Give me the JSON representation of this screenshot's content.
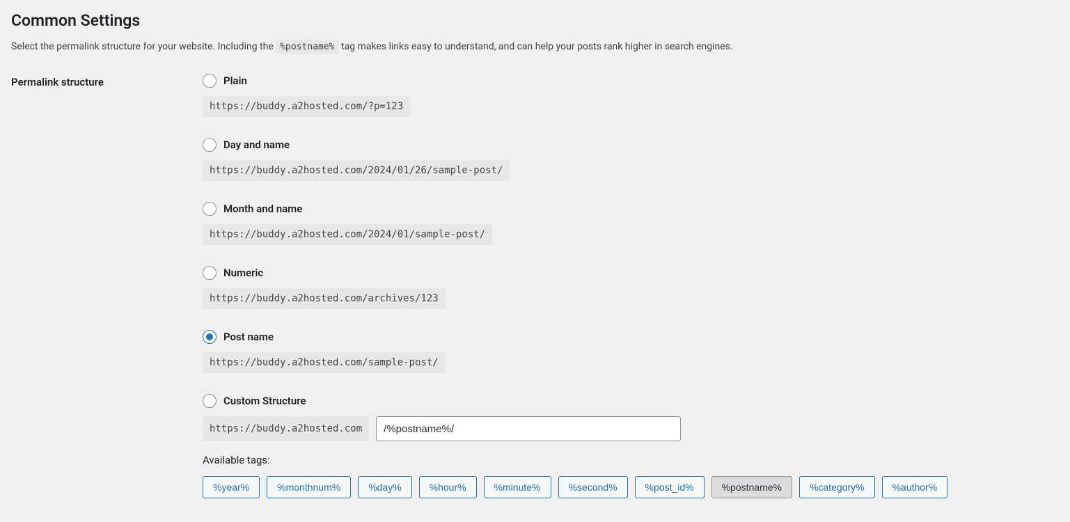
{
  "heading": "Common Settings",
  "intro_before": "Select the permalink structure for your website. Including the ",
  "intro_tag": "%postname%",
  "intro_after": " tag makes links easy to understand, and can help your posts rank higher in search engines.",
  "left_label": "Permalink structure",
  "options": [
    {
      "label": "Plain",
      "example": "https://buddy.a2hosted.com/?p=123",
      "checked": false
    },
    {
      "label": "Day and name",
      "example": "https://buddy.a2hosted.com/2024/01/26/sample-post/",
      "checked": false
    },
    {
      "label": "Month and name",
      "example": "https://buddy.a2hosted.com/2024/01/sample-post/",
      "checked": false
    },
    {
      "label": "Numeric",
      "example": "https://buddy.a2hosted.com/archives/123",
      "checked": false
    },
    {
      "label": "Post name",
      "example": "https://buddy.a2hosted.com/sample-post/",
      "checked": true
    },
    {
      "label": "Custom Structure",
      "checked": false
    }
  ],
  "custom": {
    "prefix": "https://buddy.a2hosted.com",
    "value": "/%postname%/"
  },
  "available_tags_label": "Available tags:",
  "tags": [
    {
      "label": "%year%",
      "active": false
    },
    {
      "label": "%monthnum%",
      "active": false
    },
    {
      "label": "%day%",
      "active": false
    },
    {
      "label": "%hour%",
      "active": false
    },
    {
      "label": "%minute%",
      "active": false
    },
    {
      "label": "%second%",
      "active": false
    },
    {
      "label": "%post_id%",
      "active": false
    },
    {
      "label": "%postname%",
      "active": true
    },
    {
      "label": "%category%",
      "active": false
    },
    {
      "label": "%author%",
      "active": false
    }
  ]
}
